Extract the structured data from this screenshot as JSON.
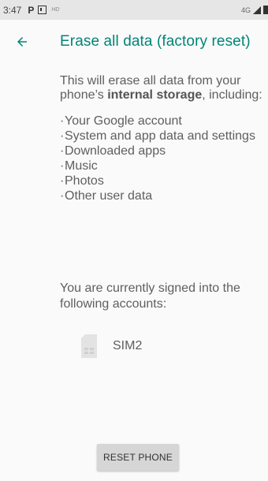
{
  "status_bar": {
    "time": "3:47",
    "notification_letter": "P",
    "hd_label": "HD",
    "network": "4G"
  },
  "header": {
    "title": "Erase all data (factory reset)"
  },
  "content": {
    "intro_before": "This will erase all data from your phone’s ",
    "intro_bold": "internal storage",
    "intro_after": ", including:",
    "items": [
      "Your Google account",
      "System and app data and settings",
      "Downloaded apps",
      "Music",
      "Photos",
      "Other user data"
    ],
    "accounts_text": "You are currently signed into the following accounts:",
    "account_label": "SIM2"
  },
  "footer": {
    "reset_button": "RESET PHONE"
  },
  "colors": {
    "accent": "#008577",
    "status_bar_bg": "#e6e6e6",
    "background": "#fafafa",
    "button_bg": "#d6d6d6"
  },
  "icons": {
    "back": "arrow-left",
    "sim": "sim-card",
    "signal": "cell-signal",
    "battery": "battery"
  }
}
